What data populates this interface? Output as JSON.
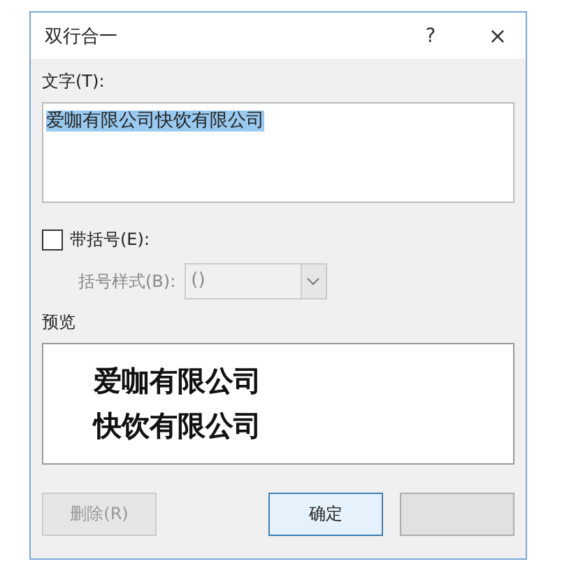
{
  "window": {
    "title": "双行合一",
    "help": "?",
    "close": "×"
  },
  "text_field": {
    "label": "文字(T):",
    "value": "爱咖有限公司快饮有限公司",
    "selected": true
  },
  "bracket_checkbox": {
    "label": "带括号(E):",
    "checked": false
  },
  "bracket_style": {
    "label": "括号样式(B):",
    "value": "()",
    "disabled": true
  },
  "preview": {
    "label": "预览",
    "lines": [
      "爱咖有限公司",
      "快饮有限公司"
    ]
  },
  "buttons": [
    {
      "label": "删除(R)",
      "disabled": true,
      "default": false
    },
    {
      "label": "确定",
      "disabled": false,
      "default": true
    },
    {
      "disabled": false,
      "default": false
    }
  ]
}
